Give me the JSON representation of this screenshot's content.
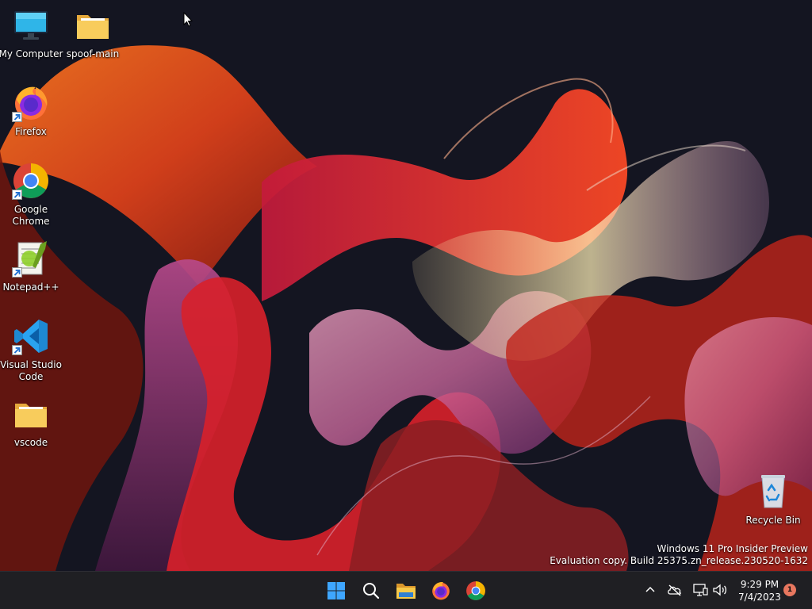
{
  "desktop": {
    "icons": [
      {
        "label": "My Computer",
        "icon": "monitor-icon"
      },
      {
        "label": "spoof-main",
        "icon": "folder-icon"
      },
      {
        "label": "Firefox",
        "icon": "firefox-icon",
        "shortcut": true
      },
      {
        "label": "Google Chrome",
        "icon": "chrome-icon",
        "shortcut": true
      },
      {
        "label": "Notepad++",
        "icon": "notepad-plus-plus-icon",
        "shortcut": true
      },
      {
        "label": "Visual Studio Code",
        "icon": "vscode-icon",
        "shortcut": true
      },
      {
        "label": "vscode",
        "icon": "folder-icon"
      },
      {
        "label": "Recycle Bin",
        "icon": "recycle-bin-icon"
      }
    ]
  },
  "watermark": {
    "line1": "Windows 11 Pro Insider Preview",
    "line2": "Evaluation copy. Build 25375.zn_release.230520-1632"
  },
  "taskbar": {
    "apps": [
      {
        "name": "Start",
        "icon": "windows-start-icon"
      },
      {
        "name": "Search",
        "icon": "search-icon"
      },
      {
        "name": "File Explorer",
        "icon": "file-explorer-icon"
      },
      {
        "name": "Firefox",
        "icon": "firefox-icon"
      },
      {
        "name": "Google Chrome",
        "icon": "chrome-icon"
      }
    ],
    "tray": {
      "icons": [
        "chevron-up-icon",
        "onedrive-offline-icon",
        "network-icon",
        "volume-icon"
      ],
      "time": "9:29 PM",
      "date": "7/4/2023",
      "notification_count": "1"
    }
  },
  "colors": {
    "taskbar_bg": "#1f1f23",
    "desktop_bg": "#141521",
    "notification_badge": "#e8775f"
  }
}
